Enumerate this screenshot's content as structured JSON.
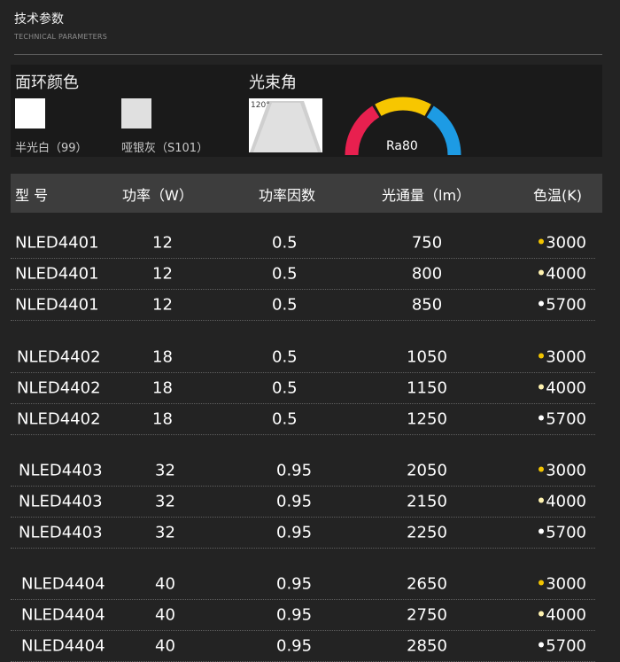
{
  "section": {
    "title": "技术参数",
    "subtitle": "TECHNICAL PARAMETERS"
  },
  "surface_color": {
    "label": "面环颜色",
    "swatches": [
      {
        "name": "半光白（99）",
        "color": "#ffffff"
      },
      {
        "name": "哑银灰（S101）",
        "color": "#e0e0e0"
      }
    ]
  },
  "beam_angle": {
    "label": "光束角",
    "value": "120°"
  },
  "ra_gauge": {
    "label": "Ra80",
    "colors": [
      "#e8204f",
      "#f7c600",
      "#1d9be4"
    ]
  },
  "table": {
    "headers": [
      "型  号",
      "功率（W）",
      "功率因数",
      "光通量（lm）",
      "色温(K)"
    ],
    "rows": [
      {
        "model": "NLED4401",
        "power": "12",
        "pf": "0.5",
        "lumen": "750",
        "cct": "3000",
        "dot": "#f2c400"
      },
      {
        "model": "NLED4401",
        "power": "12",
        "pf": "0.5",
        "lumen": "800",
        "cct": "4000",
        "dot": "#fff3b0"
      },
      {
        "model": "NLED4401",
        "power": "12",
        "pf": "0.5",
        "lumen": "850",
        "cct": "5700",
        "dot": "#ffffff"
      },
      {
        "model": "NLED4402",
        "power": "18",
        "pf": "0.5",
        "lumen": "1050",
        "cct": "3000",
        "dot": "#f2c400"
      },
      {
        "model": "NLED4402",
        "power": "18",
        "pf": "0.5",
        "lumen": "1150",
        "cct": "4000",
        "dot": "#fff3b0"
      },
      {
        "model": "NLED4402",
        "power": "18",
        "pf": "0.5",
        "lumen": "1250",
        "cct": "5700",
        "dot": "#ffffff"
      },
      {
        "model": "NLED4403",
        "power": "32",
        "pf": "0.95",
        "lumen": "2050",
        "cct": "3000",
        "dot": "#f2c400"
      },
      {
        "model": "NLED4403",
        "power": "32",
        "pf": "0.95",
        "lumen": "2150",
        "cct": "4000",
        "dot": "#fff3b0"
      },
      {
        "model": "NLED4403",
        "power": "32",
        "pf": "0.95",
        "lumen": "2250",
        "cct": "5700",
        "dot": "#ffffff"
      },
      {
        "model": "NLED4404",
        "power": "40",
        "pf": "0.95",
        "lumen": "2650",
        "cct": "3000",
        "dot": "#f2c400"
      },
      {
        "model": "NLED4404",
        "power": "40",
        "pf": "0.95",
        "lumen": "2750",
        "cct": "4000",
        "dot": "#fff3b0"
      },
      {
        "model": "NLED4404",
        "power": "40",
        "pf": "0.95",
        "lumen": "2850",
        "cct": "5700",
        "dot": "#ffffff"
      }
    ]
  }
}
